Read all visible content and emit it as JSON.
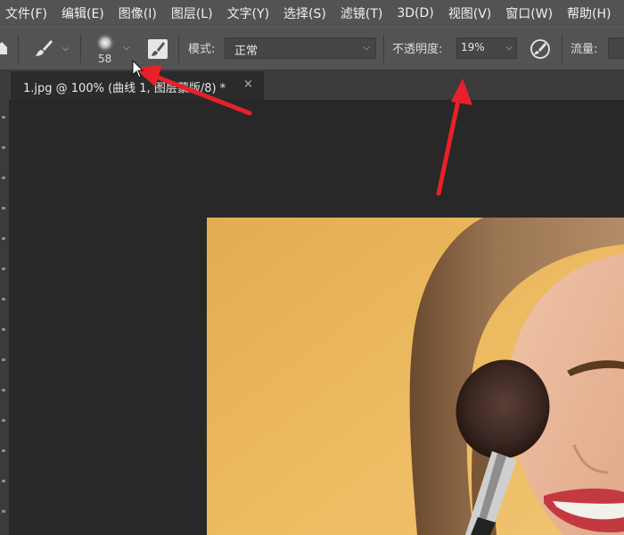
{
  "menu": [
    "文件(F)",
    "编辑(E)",
    "图像(I)",
    "图层(L)",
    "文字(Y)",
    "选择(S)",
    "滤镜(T)",
    "3D(D)",
    "视图(V)",
    "窗口(W)",
    "帮助(H)"
  ],
  "options": {
    "brush_size": "58",
    "mode_label": "模式:",
    "mode_value": "正常",
    "opacity_label": "不透明度:",
    "opacity_value": "19%",
    "flow_label": "流量:"
  },
  "tab": {
    "title": "1.jpg @ 100% (曲线 1, 图层蒙版/8) *",
    "close": "×"
  },
  "icons": {
    "home": "home-icon",
    "brush_tool": "brush-icon",
    "brush_preset": "soft-round-brush-icon",
    "brush_panel": "brush-settings-icon",
    "pressure": "airbrush-pressure-icon",
    "close": "close-icon"
  },
  "colors": {
    "menubar": "#535353",
    "canvas": "#282828",
    "annotation_arrow": "#e8202a"
  }
}
